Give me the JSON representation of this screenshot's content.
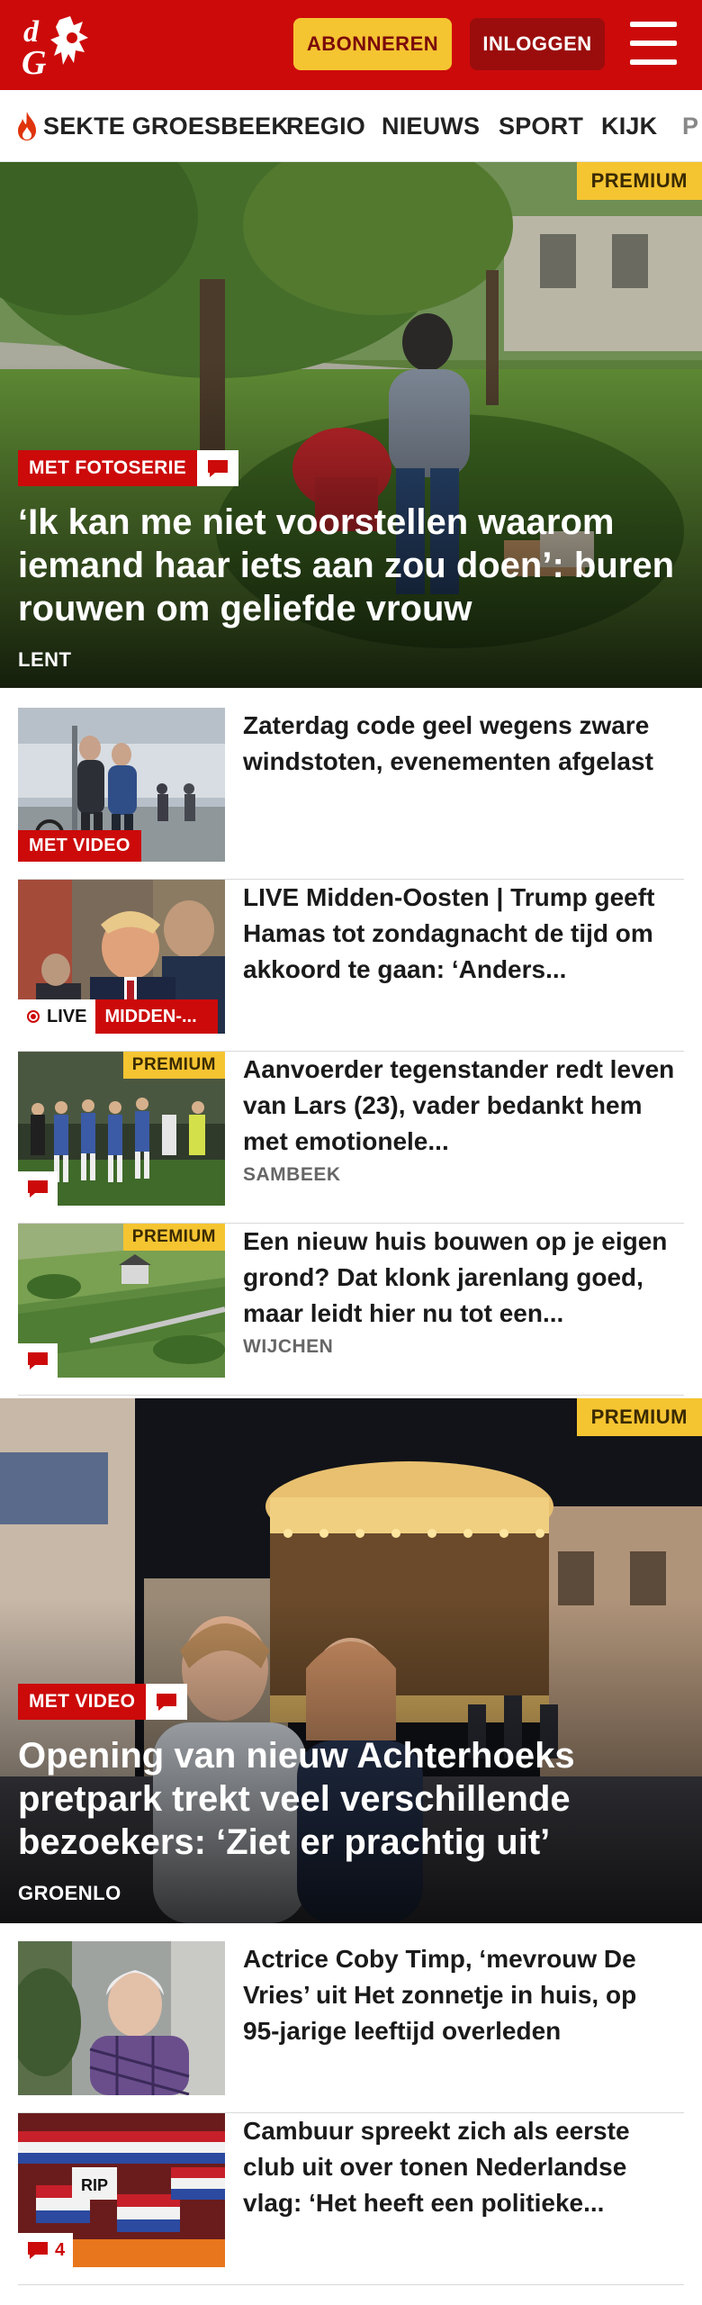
{
  "header": {
    "logo_text": "dG",
    "subscribe_label": "ABONNEREN",
    "login_label": "INLOGGEN",
    "brand_color": "#cc0a0a",
    "accent_color": "#f5c431"
  },
  "nav": {
    "items": [
      {
        "label": "SEKTE GROESBEEK",
        "icon": "flame-icon"
      },
      {
        "label": "REGIO"
      },
      {
        "label": "NIEUWS"
      },
      {
        "label": "SPORT"
      },
      {
        "label": "KIJK"
      },
      {
        "label": "P"
      }
    ]
  },
  "hero1": {
    "premium": "PREMIUM",
    "tag": "MET FOTOSERIE",
    "title": "‘Ik kan me niet voorstellen waarom iemand haar iets aan zou doen’: buren rouwen om geliefde vrouw",
    "location": "LENT"
  },
  "articles": [
    {
      "title": "Zaterdag code geel wegens zware windstoten, evenementen afgelast",
      "tag": "MET VIDEO"
    },
    {
      "title": "LIVE Midden-Oosten | Trump geeft Hamas tot zondagnacht de tijd om akkoord te gaan: ‘Anders...",
      "live_label": "LIVE",
      "live_category": "MIDDEN-..."
    },
    {
      "title": "Aanvoerder tegenstander redt leven van Lars (23), vader bedankt hem met emotionele...",
      "premium": "PREMIUM",
      "location": "SAMBEEK"
    },
    {
      "title": "Een nieuw huis bouwen op je eigen grond? Dat klonk jarenlang goed, maar leidt hier nu tot een...",
      "premium": "PREMIUM",
      "location": "WIJCHEN"
    }
  ],
  "hero2": {
    "premium": "PREMIUM",
    "tag": "MET VIDEO",
    "title": "Opening van nieuw Achterhoeks pretpark trekt veel verschillende bezoekers: ‘Ziet er prachtig uit’",
    "location": "GROENLO"
  },
  "articles2": [
    {
      "title": "Actrice Coby Timp, ‘mevrouw De Vries’ uit Het zonnetje in huis, op 95-jarige leeftijd overleden"
    },
    {
      "title": "Cambuur spreekt zich als eerste club uit over tonen Nederlandse vlag: ‘Het heeft een politieke...",
      "comment_count": "4"
    }
  ]
}
